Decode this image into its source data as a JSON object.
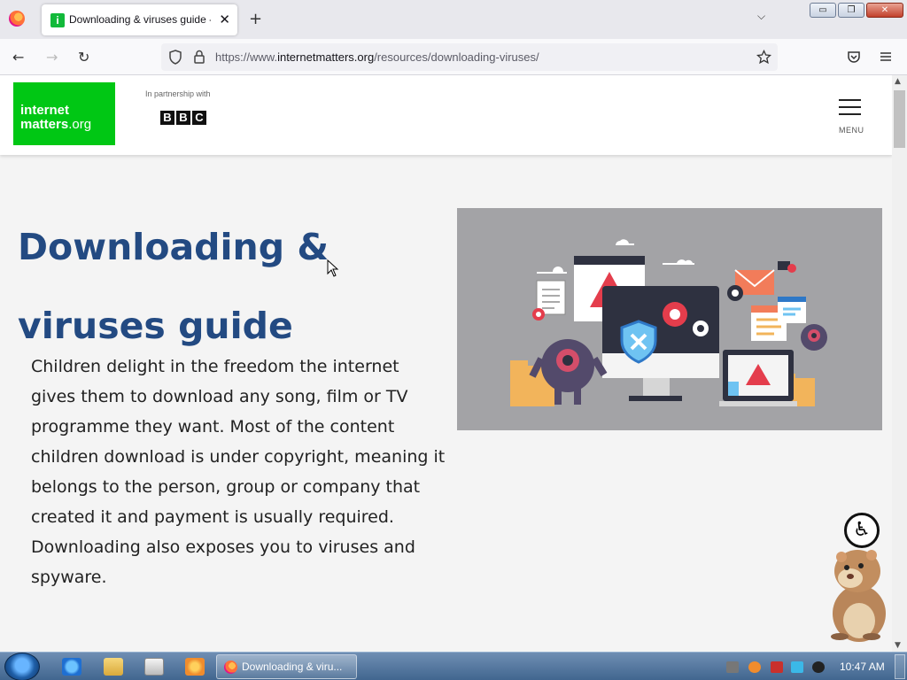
{
  "browser": {
    "tab": {
      "title": "Downloading & viruses guide -",
      "close": "✕"
    },
    "new_tab": "+",
    "tab_list": "⌵",
    "window_buttons": {
      "minimize": "▭",
      "restore": "❐",
      "close": "✕"
    },
    "nav": {
      "back": "←",
      "forward": "→",
      "reload": "↻"
    },
    "url": {
      "prefix": "https://www.",
      "domain": "internetmatters.org",
      "path": "/resources/downloading-viruses/"
    }
  },
  "site": {
    "logo_line1": "internet",
    "logo_line2": "matters",
    "logo_suffix": ".org",
    "partner_text": "In partnership with",
    "bbc_letters": [
      "B",
      "B",
      "C"
    ],
    "menu_label": "MENU"
  },
  "article": {
    "title": "Downloading & viruses guide",
    "intro": "Children delight in the freedom the internet gives them to download any song, film or TV programme they want. Most of the content children download is under copyright, meaning it belongs to the person, group or company that created it and payment is usually required. Downloading also exposes you to viruses and spyware."
  },
  "accessibility": {
    "icon": "accessibility-icon"
  },
  "taskbar": {
    "task_label": "Downloading & viru...",
    "clock": "10:47 AM"
  },
  "colors": {
    "brand_green": "#00c714",
    "title_blue": "#234a82",
    "hero_bg": "#a3a3a6"
  }
}
